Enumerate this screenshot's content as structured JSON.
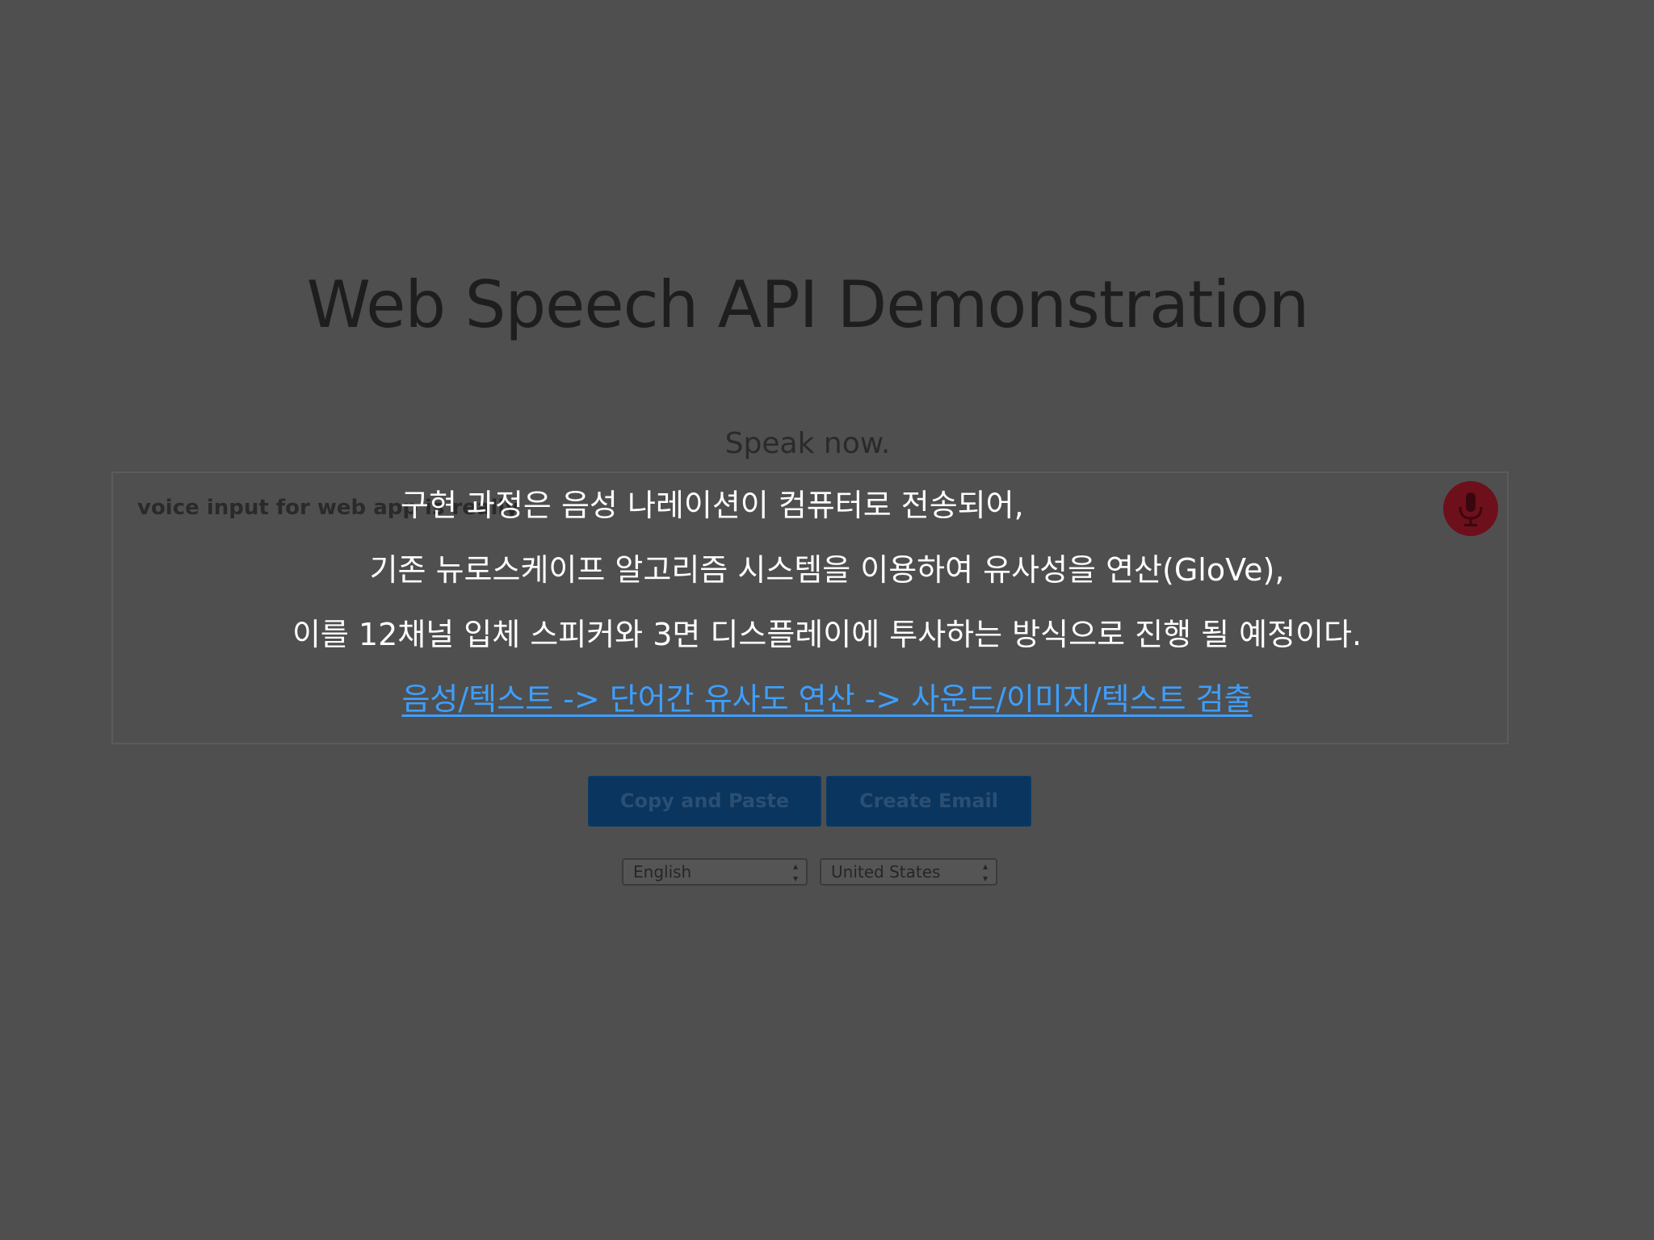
{
  "page": {
    "title": "Web Speech API Demonstration",
    "status": "Speak now."
  },
  "transcript": {
    "text": "voice input for web app is really cool"
  },
  "buttons": {
    "copy_label": "Copy and Paste",
    "email_label": "Create Email"
  },
  "selects": {
    "language": "English",
    "dialect": "United States"
  },
  "overlay": {
    "line1": "구현 과정은 음성 나레이션이 컴퓨터로 전송되어,",
    "line2": "기존 뉴로스케이프 알고리즘 시스템을 이용하여 유사성을 연산(GloVe),",
    "line3": "이를 12채널 입체 스피커와 3면 디스플레이에 투사하는 방식으로 진행 될 예정이다.",
    "link": "음성/텍스트 -> 단어간 유사도 연산 -> 사운드/이미지/텍스트 검출"
  },
  "icons": {
    "mic": "microphone-icon",
    "select_arrows": "updown-arrows-icon"
  },
  "colors": {
    "background": "#4f4f50",
    "mic_button": "#6e0f1c",
    "primary_button": "#0a355e",
    "link": "#3d9fff",
    "overlay_text": "#ffffff"
  }
}
